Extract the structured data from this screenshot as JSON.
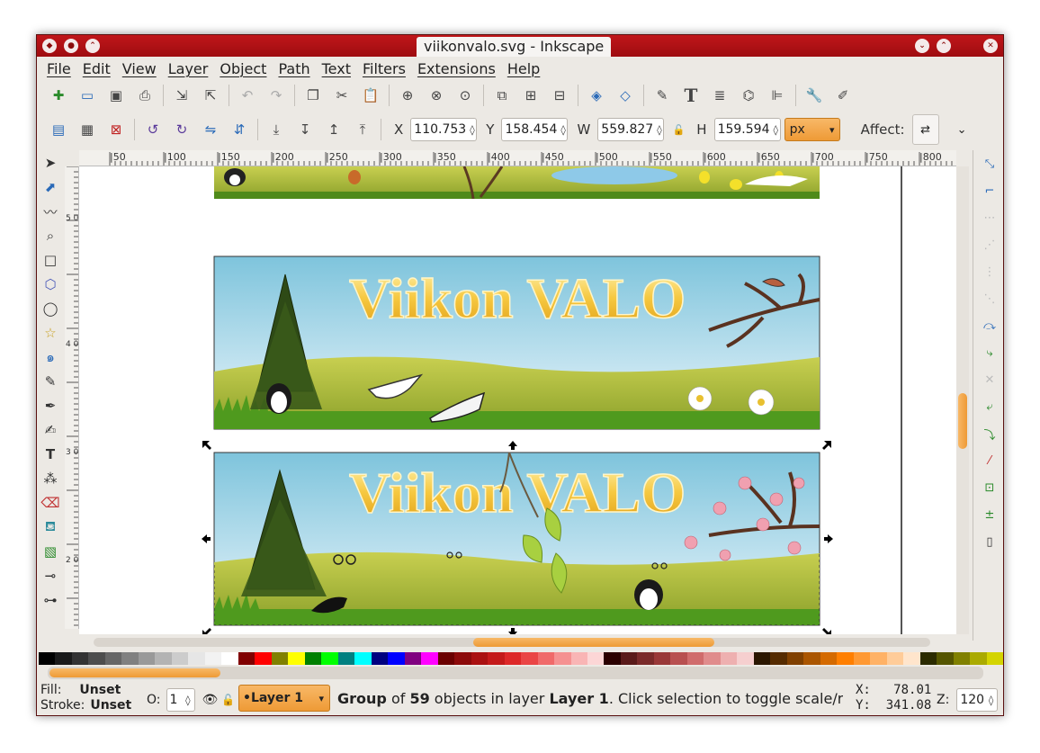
{
  "window": {
    "title": "viikonvalo.svg - Inkscape"
  },
  "menu": [
    "File",
    "Edit",
    "View",
    "Layer",
    "Object",
    "Path",
    "Text",
    "Filters",
    "Extensions",
    "Help"
  ],
  "toolbar": {
    "x_label": "X",
    "x_value": "110.753",
    "y_label": "Y",
    "y_value": "158.454",
    "w_label": "W",
    "w_value": "559.827",
    "h_label": "H",
    "h_value": "159.594",
    "unit": "px",
    "affect_label": "Affect:"
  },
  "ruler": {
    "h_ticks": [
      "|50",
      "|100",
      "|150",
      "|200",
      "|250",
      "|300",
      "|350",
      "|400",
      "|450",
      "|500",
      "|550",
      "|600",
      "|650",
      "|700",
      "|750",
      "|800"
    ],
    "v_ticks": [
      "5 0",
      "4 0 0",
      "3 0 0",
      "2 0 0"
    ]
  },
  "banners": {
    "middle_title": "Viikon VALO",
    "bottom_title": "Viikon VALO"
  },
  "status": {
    "fill_label": "Fill:",
    "fill_value": "Unset",
    "stroke_label": "Stroke:",
    "stroke_value": "Unset",
    "opacity_label": "O:",
    "opacity_value": "1",
    "layer": "•Layer 1",
    "msg_pre": "Group",
    "msg_mid1": " of ",
    "msg_count": "59",
    "msg_mid2": " objects in layer ",
    "msg_layer": "Layer 1",
    "msg_post": ". Click selection to toggle scale/ro...",
    "x_label": "X:",
    "x_value": "78.01",
    "y_label": "Y:",
    "y_value": "341.08",
    "zoom_label": "Z:",
    "zoom_value": "120"
  },
  "palette_colors": [
    "#000000",
    "#1a1a1a",
    "#333333",
    "#4d4d4d",
    "#666666",
    "#808080",
    "#999999",
    "#b3b3b3",
    "#cccccc",
    "#e6e6e6",
    "#f2f2f2",
    "#ffffff",
    "#800000",
    "#ff0000",
    "#808000",
    "#ffff00",
    "#008000",
    "#00ff00",
    "#008080",
    "#00ffff",
    "#000080",
    "#0000ff",
    "#800080",
    "#ff00ff",
    "#6b0000",
    "#8c0a0a",
    "#aa1111",
    "#c41a1a",
    "#dd2828",
    "#ea4545",
    "#f06a6a",
    "#f59191",
    "#f9b5b5",
    "#fcd6d6",
    "#2b0000",
    "#5a1a1a",
    "#7a2a2a",
    "#993838",
    "#b85050",
    "#d06c6c",
    "#e08c8c",
    "#eeb0b0",
    "#f6cfcf",
    "#2b1600",
    "#552b00",
    "#804000",
    "#aa5500",
    "#d46a00",
    "#ff7f00",
    "#ff9933",
    "#ffb266",
    "#ffcc99",
    "#ffe5cc",
    "#2b2b00",
    "#555500",
    "#808000",
    "#aaaa00",
    "#d4d400"
  ],
  "colors": {
    "accent": "#ee9a36",
    "titlebar": "#b01014"
  }
}
